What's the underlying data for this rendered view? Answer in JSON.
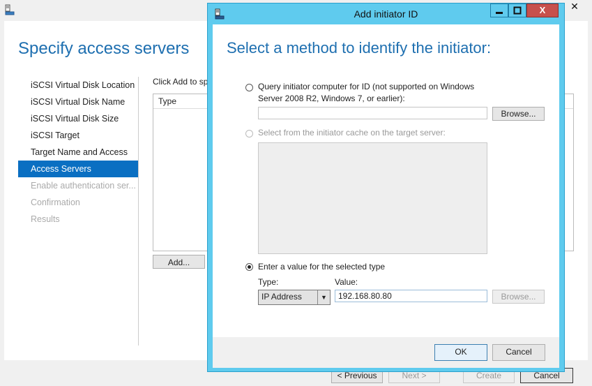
{
  "wizard": {
    "title": "Specify access servers",
    "close_glyph": "✕",
    "nav": [
      {
        "label": "iSCSI Virtual Disk Location",
        "state": "normal"
      },
      {
        "label": "iSCSI Virtual Disk Name",
        "state": "normal"
      },
      {
        "label": "iSCSI Virtual Disk Size",
        "state": "normal"
      },
      {
        "label": "iSCSI Target",
        "state": "normal"
      },
      {
        "label": "Target Name and Access",
        "state": "normal"
      },
      {
        "label": "Access Servers",
        "state": "active"
      },
      {
        "label": "Enable authentication ser...",
        "state": "disabled"
      },
      {
        "label": "Confirmation",
        "state": "disabled"
      },
      {
        "label": "Results",
        "state": "disabled"
      }
    ],
    "instruction": "Click Add to sp",
    "list_header": "Type",
    "add_button": "Add...",
    "buttons": {
      "previous": "< Previous",
      "next": "Next >",
      "create": "Create",
      "cancel": "Cancel"
    }
  },
  "dialog": {
    "title": "Add initiator ID",
    "close_glyph": "X",
    "heading": "Select a method to identify the initiator:",
    "option_query": {
      "label_line1": "Query initiator computer for ID (not supported on Windows",
      "label_line2": "Server 2008 R2, Windows 7, or earlier):",
      "value": "",
      "browse": "Browse...",
      "selected": false
    },
    "option_cache": {
      "label": "Select from the initiator cache on the target server:",
      "enabled": false
    },
    "option_value": {
      "label": "Enter a value for the selected type",
      "selected": true,
      "type_label": "Type:",
      "type_value": "IP Address",
      "value_label": "Value:",
      "value": "192.168.80.80",
      "browse": "Browse..."
    },
    "ok": "OK",
    "cancel": "Cancel"
  },
  "colors": {
    "accent": "#1e6fb0",
    "nav_active": "#0a6fc2",
    "dialog_frame": "#5fcbee",
    "close_button": "#c7504c"
  }
}
